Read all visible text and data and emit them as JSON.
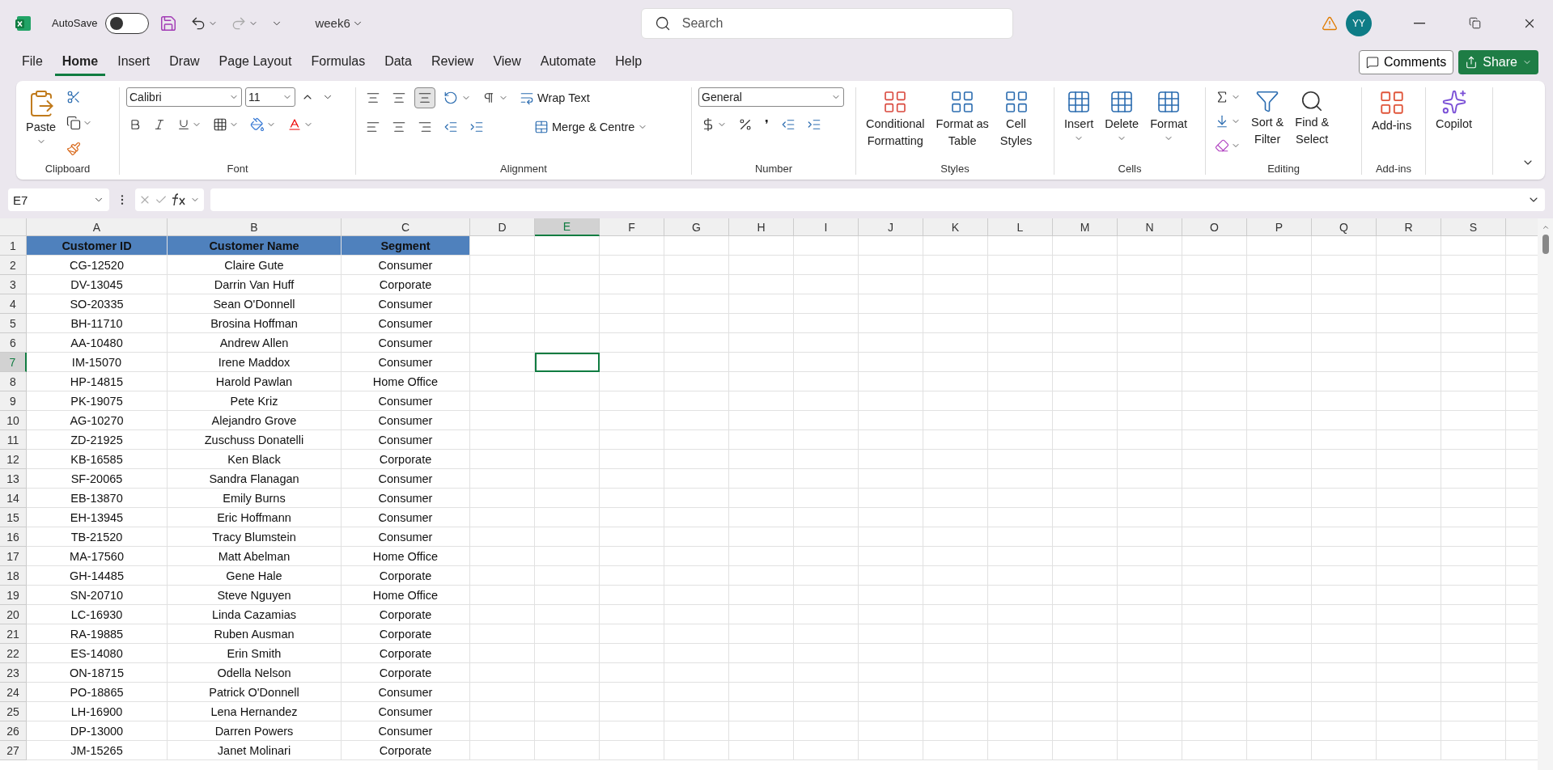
{
  "title_bar": {
    "autosave_label": "AutoSave",
    "autosave_on": false,
    "filename": "week6",
    "search_placeholder": "Search",
    "avatar": "YY"
  },
  "menu_tabs": [
    {
      "label": "File",
      "selected": false
    },
    {
      "label": "Home",
      "selected": true
    },
    {
      "label": "Insert",
      "selected": false
    },
    {
      "label": "Draw",
      "selected": false
    },
    {
      "label": "Page Layout",
      "selected": false
    },
    {
      "label": "Formulas",
      "selected": false
    },
    {
      "label": "Data",
      "selected": false
    },
    {
      "label": "Review",
      "selected": false
    },
    {
      "label": "View",
      "selected": false
    },
    {
      "label": "Automate",
      "selected": false
    },
    {
      "label": "Help",
      "selected": false
    }
  ],
  "comments_label": "Comments",
  "share_label": "Share",
  "ribbon": [
    {
      "kind": "clipboard",
      "label": "Clipboard",
      "paste": "Paste"
    },
    {
      "kind": "font",
      "label": "Font",
      "font": "Calibri",
      "size": "11"
    },
    {
      "kind": "alignment",
      "label": "Alignment",
      "wrap": "Wrap Text",
      "merge": "Merge & Centre",
      "bottom_align_on": true
    },
    {
      "kind": "number",
      "label": "Number",
      "format": "General",
      "comma": "❜"
    },
    {
      "kind": "styles",
      "label": "Styles",
      "buttons": [
        [
          "Conditional",
          "Formatting"
        ],
        [
          "Format as",
          "Table"
        ],
        [
          "Cell",
          "Styles"
        ]
      ]
    },
    {
      "kind": "cells",
      "label": "Cells",
      "buttons": [
        "Insert",
        "Delete",
        "Format"
      ]
    },
    {
      "kind": "editing",
      "label": "Editing",
      "buttons": [
        [
          "Sort &",
          "Filter"
        ],
        [
          "Find &",
          "Select"
        ]
      ]
    },
    {
      "kind": "addins",
      "label": "Add-ins",
      "button": "Add-ins"
    },
    {
      "kind": "copilot",
      "button": "Copilot"
    }
  ],
  "name_box": "E7",
  "columns": [
    {
      "label": "A",
      "selected": false
    },
    {
      "label": "B",
      "selected": false
    },
    {
      "label": "C",
      "selected": false
    },
    {
      "label": "D",
      "selected": false
    },
    {
      "label": "E",
      "selected": true
    },
    {
      "label": "F",
      "selected": false
    },
    {
      "label": "G",
      "selected": false
    },
    {
      "label": "H",
      "selected": false
    },
    {
      "label": "I",
      "selected": false
    },
    {
      "label": "J",
      "selected": false
    },
    {
      "label": "K",
      "selected": false
    },
    {
      "label": "L",
      "selected": false
    },
    {
      "label": "M",
      "selected": false
    },
    {
      "label": "N",
      "selected": false
    },
    {
      "label": "O",
      "selected": false
    },
    {
      "label": "P",
      "selected": false
    },
    {
      "label": "Q",
      "selected": false
    },
    {
      "label": "R",
      "selected": false
    },
    {
      "label": "S",
      "selected": false
    }
  ],
  "rows": [
    {
      "number": "1",
      "selected": false,
      "header": true,
      "cells": [
        "Customer ID",
        "Customer Name",
        "Segment"
      ]
    },
    {
      "number": "2",
      "selected": false,
      "header": false,
      "cells": [
        "CG-12520",
        "Claire Gute",
        "Consumer"
      ]
    },
    {
      "number": "3",
      "selected": false,
      "header": false,
      "cells": [
        "DV-13045",
        "Darrin Van Huff",
        "Corporate"
      ]
    },
    {
      "number": "4",
      "selected": false,
      "header": false,
      "cells": [
        "SO-20335",
        "Sean O'Donnell",
        "Consumer"
      ]
    },
    {
      "number": "5",
      "selected": false,
      "header": false,
      "cells": [
        "BH-11710",
        "Brosina Hoffman",
        "Consumer"
      ]
    },
    {
      "number": "6",
      "selected": false,
      "header": false,
      "cells": [
        "AA-10480",
        "Andrew Allen",
        "Consumer"
      ]
    },
    {
      "number": "7",
      "selected": true,
      "header": false,
      "cells": [
        "IM-15070",
        "Irene Maddox",
        "Consumer"
      ]
    },
    {
      "number": "8",
      "selected": false,
      "header": false,
      "cells": [
        "HP-14815",
        "Harold Pawlan",
        "Home Office"
      ]
    },
    {
      "number": "9",
      "selected": false,
      "header": false,
      "cells": [
        "PK-19075",
        "Pete Kriz",
        "Consumer"
      ]
    },
    {
      "number": "10",
      "selected": false,
      "header": false,
      "cells": [
        "AG-10270",
        "Alejandro Grove",
        "Consumer"
      ]
    },
    {
      "number": "11",
      "selected": false,
      "header": false,
      "cells": [
        "ZD-21925",
        "Zuschuss Donatelli",
        "Consumer"
      ]
    },
    {
      "number": "12",
      "selected": false,
      "header": false,
      "cells": [
        "KB-16585",
        "Ken Black",
        "Corporate"
      ]
    },
    {
      "number": "13",
      "selected": false,
      "header": false,
      "cells": [
        "SF-20065",
        "Sandra Flanagan",
        "Consumer"
      ]
    },
    {
      "number": "14",
      "selected": false,
      "header": false,
      "cells": [
        "EB-13870",
        "Emily Burns",
        "Consumer"
      ]
    },
    {
      "number": "15",
      "selected": false,
      "header": false,
      "cells": [
        "EH-13945",
        "Eric Hoffmann",
        "Consumer"
      ]
    },
    {
      "number": "16",
      "selected": false,
      "header": false,
      "cells": [
        "TB-21520",
        "Tracy Blumstein",
        "Consumer"
      ]
    },
    {
      "number": "17",
      "selected": false,
      "header": false,
      "cells": [
        "MA-17560",
        "Matt Abelman",
        "Home Office"
      ]
    },
    {
      "number": "18",
      "selected": false,
      "header": false,
      "cells": [
        "GH-14485",
        "Gene Hale",
        "Corporate"
      ]
    },
    {
      "number": "19",
      "selected": false,
      "header": false,
      "cells": [
        "SN-20710",
        "Steve Nguyen",
        "Home Office"
      ]
    },
    {
      "number": "20",
      "selected": false,
      "header": false,
      "cells": [
        "LC-16930",
        "Linda Cazamias",
        "Corporate"
      ]
    },
    {
      "number": "21",
      "selected": false,
      "header": false,
      "cells": [
        "RA-19885",
        "Ruben Ausman",
        "Corporate"
      ]
    },
    {
      "number": "22",
      "selected": false,
      "header": false,
      "cells": [
        "ES-14080",
        "Erin Smith",
        "Corporate"
      ]
    },
    {
      "number": "23",
      "selected": false,
      "header": false,
      "cells": [
        "ON-18715",
        "Odella Nelson",
        "Corporate"
      ]
    },
    {
      "number": "24",
      "selected": false,
      "header": false,
      "cells": [
        "PO-18865",
        "Patrick O'Donnell",
        "Consumer"
      ]
    },
    {
      "number": "25",
      "selected": false,
      "header": false,
      "cells": [
        "LH-16900",
        "Lena Hernandez",
        "Consumer"
      ]
    },
    {
      "number": "26",
      "selected": false,
      "header": false,
      "cells": [
        "DP-13000",
        "Darren Powers",
        "Consumer"
      ]
    },
    {
      "number": "27",
      "selected": false,
      "header": false,
      "cells": [
        "JM-15265",
        "Janet Molinari",
        "Corporate"
      ]
    }
  ]
}
